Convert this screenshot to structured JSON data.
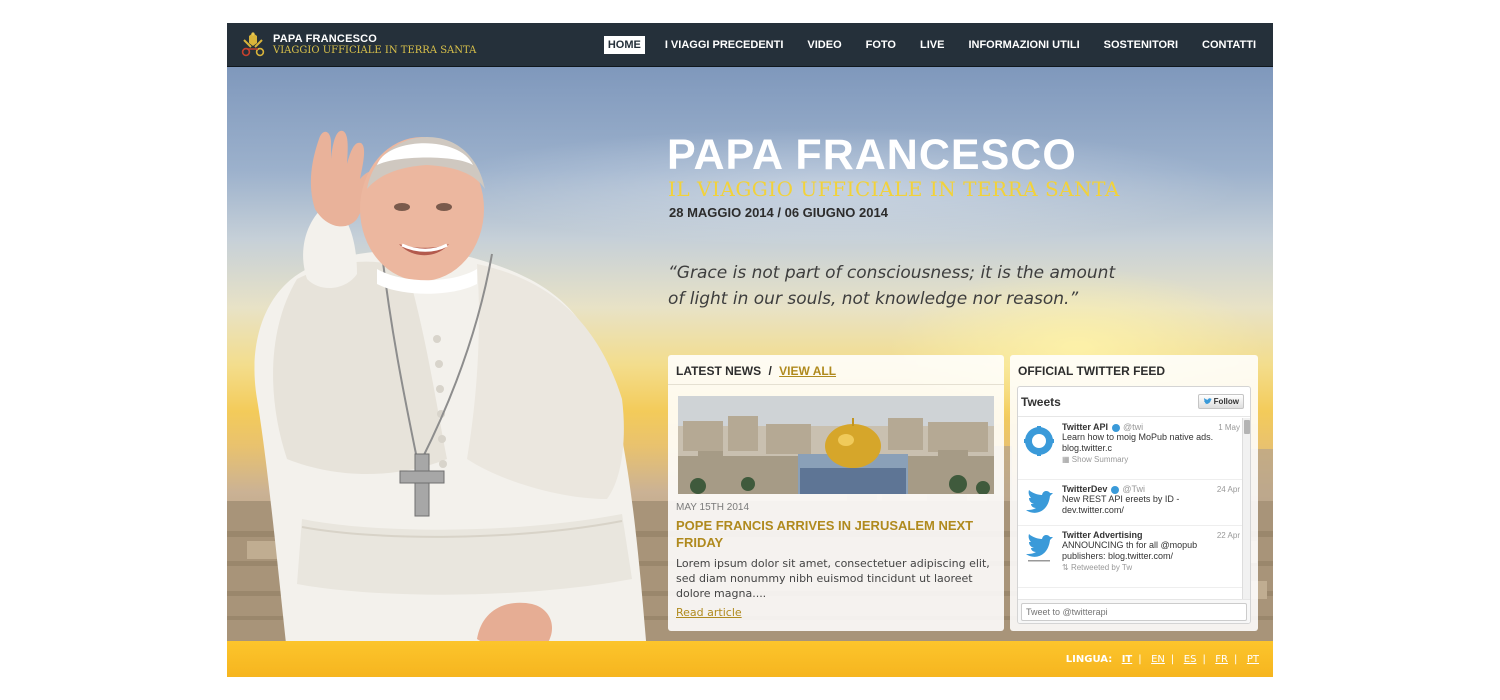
{
  "brand": {
    "title": "PAPA FRANCESCO",
    "subtitle": "VIAGGIO UFFICIALE IN TERRA SANTA"
  },
  "nav": {
    "items": [
      {
        "label": "HOME",
        "active": true
      },
      {
        "label": "I VIAGGI PRECEDENTI"
      },
      {
        "label": "VIDEO"
      },
      {
        "label": "FOTO"
      },
      {
        "label": "LIVE"
      },
      {
        "label": "INFORMAZIONI UTILI"
      },
      {
        "label": "SOSTENITORI"
      },
      {
        "label": "CONTATTI"
      }
    ]
  },
  "hero": {
    "title": "PAPA FRANCESCO",
    "subtitle": "IL VIAGGIO UFFICIALE IN TERRA SANTA",
    "dates": "28 MAGGIO 2014 / 06 GIUGNO 2014",
    "quote_line1": "“Grace is not part of consciousness; it is the amount",
    "quote_line2": "of light in our souls, not knowledge nor reason.”"
  },
  "news": {
    "heading": "LATEST NEWS",
    "separator": "/",
    "view_all": "VIEW ALL",
    "date": "MAY 15TH 2014",
    "headline": "POPE FRANCIS ARRIVES IN JERUSALEM NEXT FRIDAY",
    "body": "Lorem ipsum dolor sit amet, consectetuer adipiscing elit, sed diam nonummy nibh euismod tincidunt ut laoreet dolore magna....",
    "read_more": "Read article"
  },
  "twitter": {
    "heading": "OFFICIAL TWITTER FEED",
    "widget_title": "Tweets",
    "follow_label": "Follow",
    "tweets": [
      {
        "name": "Twitter API",
        "handle": "@twi",
        "time": "1 May",
        "text": "Learn how to moig MoPub native ads. blog.twitter.c",
        "meta": "Show Summary"
      },
      {
        "name": "TwitterDev",
        "handle": "@Twi",
        "time": "24 Apr",
        "text": "New REST API ereets by ID - dev.twitter.com/",
        "meta": ""
      },
      {
        "name": "Twitter Advertising",
        "handle": "",
        "time": "22 Apr",
        "text": "ANNOUNCING th for all @mopub publishers: blog.twitter.com/",
        "meta": "Retweeted by Tw"
      }
    ],
    "compose_placeholder": "Tweet to @twitterapi"
  },
  "footer": {
    "lang_label": "LINGUA:",
    "languages": [
      "IT",
      "EN",
      "ES",
      "FR",
      "PT"
    ],
    "active_language": "IT"
  },
  "colors": {
    "header_bg": "#25303a",
    "accent_gold": "#b08a1e",
    "subtitle_yellow": "#f2d23a",
    "footer_yellow": "#fcc52c",
    "twitter_blue": "#3a9ad9"
  }
}
